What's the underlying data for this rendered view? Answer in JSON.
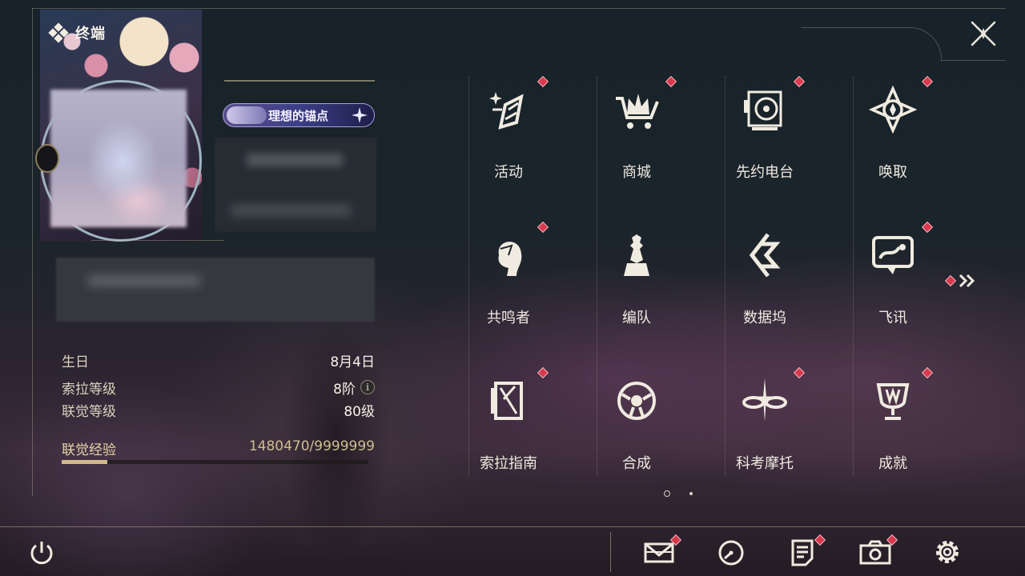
{
  "header": {
    "title": "终端"
  },
  "profile": {
    "badge_label": "理想的锚点",
    "stats": [
      {
        "label": "生日",
        "value": "8月4日"
      },
      {
        "label": "索拉等级",
        "value": "8阶"
      },
      {
        "label": "联觉等级",
        "value": "80级"
      }
    ],
    "info_symbol": "i",
    "exp": {
      "label": "联觉经验",
      "value": "1480470/9999999",
      "progress": 0.148
    }
  },
  "menu": {
    "items": [
      {
        "label": "活动",
        "icon": "activity-icon",
        "notify": true
      },
      {
        "label": "商城",
        "icon": "shop-cart-icon",
        "notify": true
      },
      {
        "label": "先约电台",
        "icon": "radio-icon",
        "notify": true
      },
      {
        "label": "唤取",
        "icon": "convene-icon",
        "notify": true
      },
      {
        "label": "共鸣者",
        "icon": "resonator-icon",
        "notify": true
      },
      {
        "label": "编队",
        "icon": "team-chess-icon",
        "notify": false
      },
      {
        "label": "数据坞",
        "icon": "data-bank-icon",
        "notify": false
      },
      {
        "label": "飞讯",
        "icon": "chat-message-icon",
        "notify": true
      },
      {
        "label": "索拉指南",
        "icon": "guidebook-icon",
        "notify": true
      },
      {
        "label": "合成",
        "icon": "synthesis-icon",
        "notify": false
      },
      {
        "label": "科考摩托",
        "icon": "motorcycle-icon",
        "notify": true
      },
      {
        "label": "成就",
        "icon": "trophy-icon",
        "notify": true
      }
    ],
    "page_count": 2,
    "current_page": 1
  },
  "bottom_bar": {
    "items": [
      {
        "icon": "mail-icon",
        "notify": true
      },
      {
        "icon": "clock-icon",
        "notify": false
      },
      {
        "icon": "notice-icon",
        "notify": true
      },
      {
        "icon": "camera-icon",
        "notify": true
      },
      {
        "icon": "settings-gear-icon",
        "notify": false
      }
    ]
  },
  "colors": {
    "notify_red": "#d9394e",
    "text_cream": "#efeadf",
    "exp_gold": "#d3b98a",
    "badge_purple": "#3c3f86"
  }
}
